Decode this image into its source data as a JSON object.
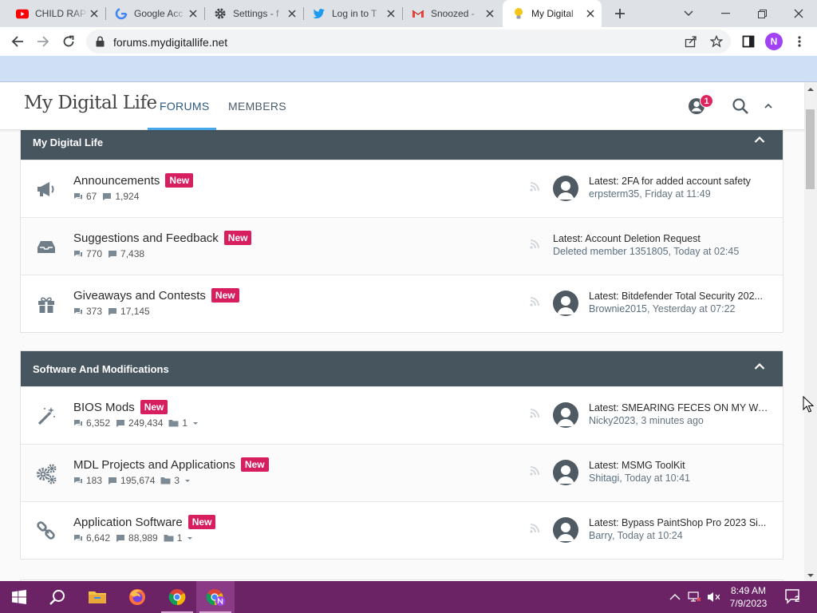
{
  "browser": {
    "tabs": [
      {
        "title": "CHILD RAPE",
        "icon": "youtube-icon",
        "active": false
      },
      {
        "title": "Google Acc",
        "icon": "google-icon",
        "active": false
      },
      {
        "title": "Settings - f",
        "icon": "gear-icon",
        "active": false
      },
      {
        "title": "Log in to T",
        "icon": "twitter-icon",
        "active": false
      },
      {
        "title": "Snoozed -",
        "icon": "gmail-icon",
        "active": false
      },
      {
        "title": "My Digital",
        "icon": "lightbulb-icon",
        "active": true
      }
    ],
    "url": "forums.mydigitallife.net",
    "profile_initial": "N"
  },
  "site": {
    "logo": "My Digital Life",
    "nav": {
      "forums": "FORUMS",
      "members": "MEMBERS"
    },
    "alerts_count": "1"
  },
  "categories": [
    {
      "title": "My Digital Life",
      "nodes": [
        {
          "title": "Announcements",
          "badge": "New",
          "threads": "67",
          "messages": "1,924",
          "subforums": "",
          "icon": "megaphone-icon",
          "has_avatar": true,
          "latest": "Latest: 2FA for added account safety",
          "user": "erpsterm35",
          "time": "Friday at 11:49"
        },
        {
          "title": "Suggestions and Feedback",
          "badge": "New",
          "threads": "770",
          "messages": "7,438",
          "subforums": "",
          "icon": "inbox-icon",
          "has_avatar": false,
          "latest": "Latest: Account Deletion Request",
          "user": "Deleted member 1351805",
          "time": "Today at 02:45"
        },
        {
          "title": "Giveaways and Contests",
          "badge": "New",
          "threads": "373",
          "messages": "17,145",
          "subforums": "",
          "icon": "gift-icon",
          "has_avatar": true,
          "latest": "Latest: Bitdefender Total Security 202...",
          "user": "Brownie2015",
          "time": "Yesterday at 07:22"
        }
      ]
    },
    {
      "title": "Software And Modifications",
      "nodes": [
        {
          "title": "BIOS Mods",
          "badge": "New",
          "threads": "6,352",
          "messages": "249,434",
          "subforums": "1",
          "icon": "magic-wand-icon",
          "has_avatar": true,
          "latest": "Latest: SMEARING FECES ON MY WA...",
          "user": "Nicky2023",
          "time": "3 minutes ago"
        },
        {
          "title": "MDL Projects and Applications",
          "badge": "New",
          "threads": "183",
          "messages": "195,674",
          "subforums": "3",
          "icon": "cogs-icon",
          "has_avatar": true,
          "latest": "Latest: MSMG ToolKit",
          "user": "Shitagi",
          "time": "Today at 10:41"
        },
        {
          "title": "Application Software",
          "badge": "New",
          "threads": "6,642",
          "messages": "88,989",
          "subforums": "1",
          "icon": "link-icon",
          "has_avatar": true,
          "latest": "Latest: Bypass PaintShop Pro 2023 Si...",
          "user": "Barry",
          "time": "Today at 10:24"
        }
      ]
    }
  ],
  "taskbar": {
    "apps": [
      "windows-start-icon",
      "search-icon",
      "file-explorer-icon",
      "firefox-icon",
      "chrome-icon",
      "chrome-profile-icon"
    ],
    "time": "8:49 AM",
    "date": "7/9/2023",
    "notifications": "2"
  },
  "colors": {
    "category_header": "#47555f",
    "new_badge": "#d71f5f",
    "nav_underline": "#47a7eb",
    "taskbar": "#6b2366",
    "page_band": "#cfdff6"
  }
}
